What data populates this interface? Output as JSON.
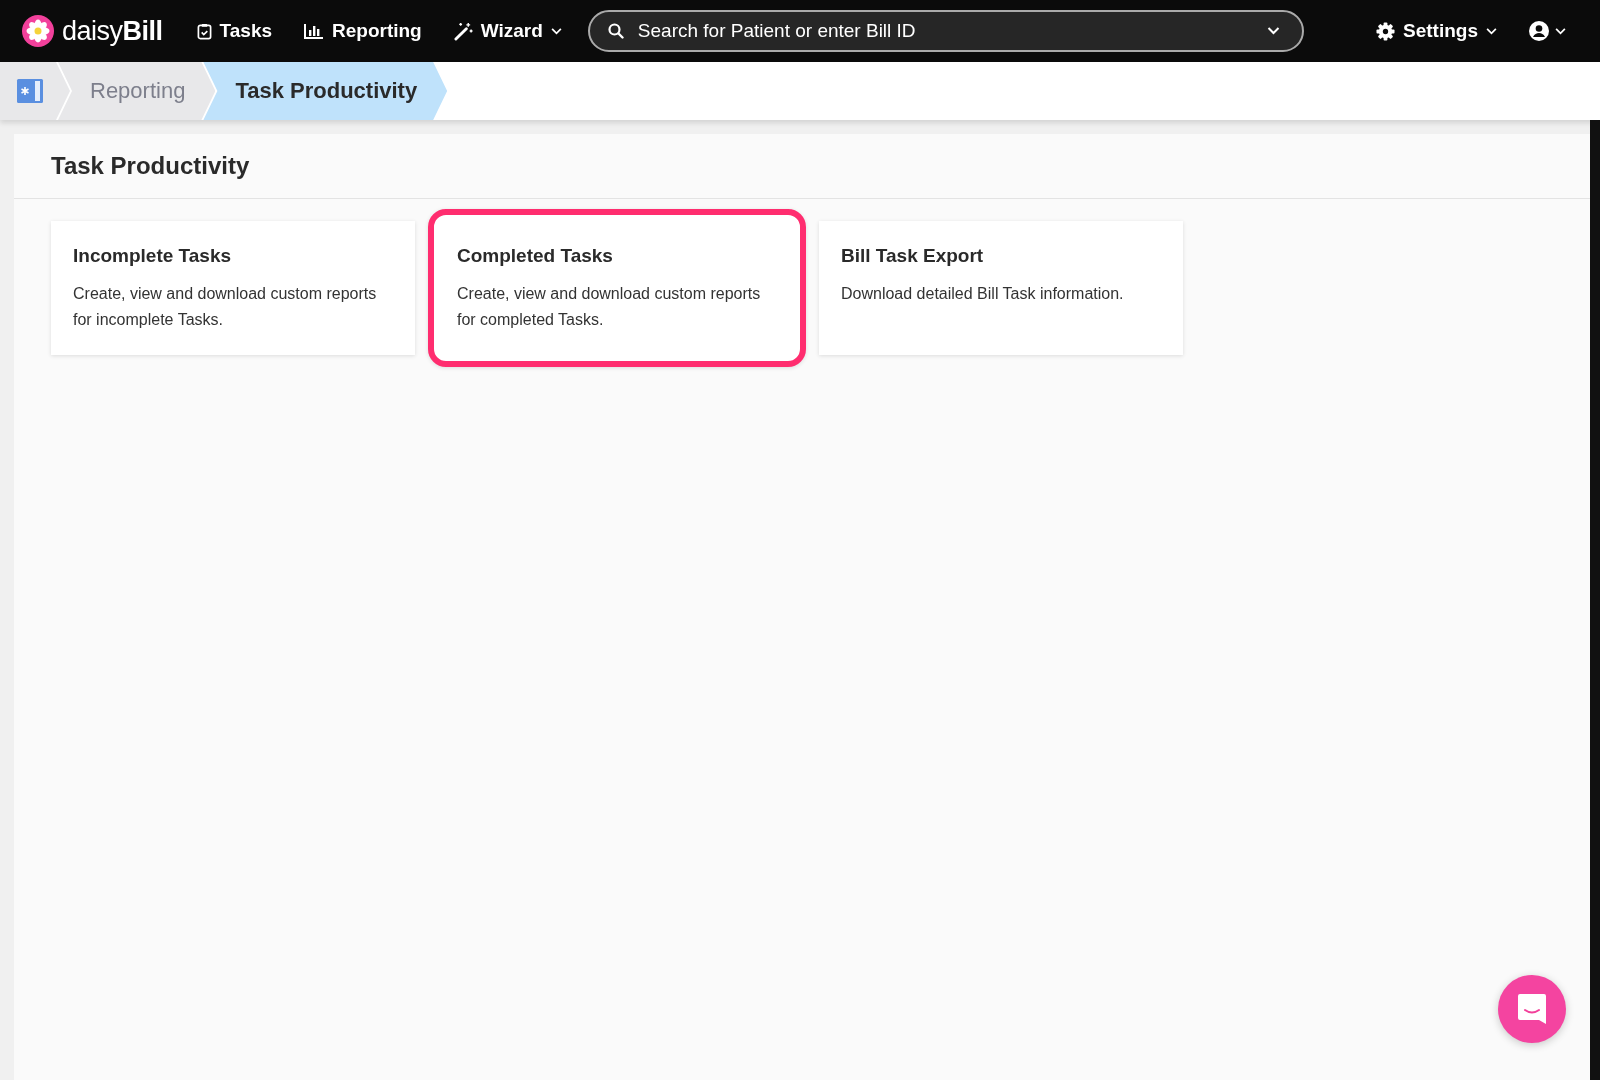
{
  "nav": {
    "brand_light": "daisy",
    "brand_bold": "Bill",
    "items": [
      {
        "label": "Tasks",
        "kind": "tasks"
      },
      {
        "label": "Reporting",
        "kind": "chart"
      },
      {
        "label": "Wizard",
        "kind": "wand"
      }
    ],
    "search": {
      "placeholder": "Search for Patient or enter Bill ID"
    },
    "settings": {
      "label": "Settings"
    }
  },
  "breadcrumb": [
    {
      "label": "Reporting",
      "selected": false
    },
    {
      "label": "Task Productivity",
      "selected": true
    }
  ],
  "page": {
    "title": "Task Productivity",
    "cards": [
      {
        "title": "Incomplete Tasks",
        "description": "Create, view and download custom reports for incomplete Tasks.",
        "highlighted": false
      },
      {
        "title": "Completed Tasks",
        "description": "Create, view and download custom reports for completed Tasks.",
        "highlighted": true
      },
      {
        "title": "Bill Task Export",
        "description": "Download detailed Bill Task information.",
        "highlighted": false
      }
    ]
  }
}
